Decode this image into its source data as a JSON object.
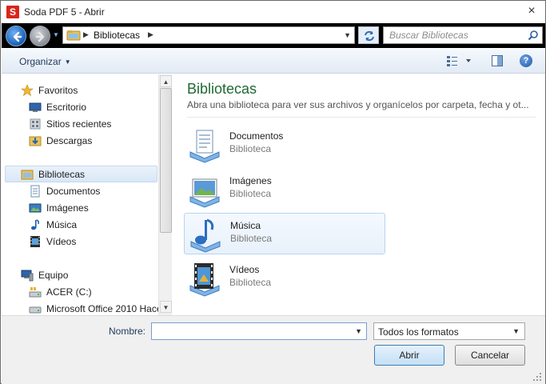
{
  "window": {
    "title": "Soda PDF 5 - Abrir",
    "app_icon_letter": "S",
    "close_glyph": "×"
  },
  "navbar": {
    "breadcrumb": "Bibliotecas",
    "search_placeholder": "Buscar Bibliotecas"
  },
  "commandbar": {
    "organize_label": "Organizar",
    "help_glyph": "?"
  },
  "navpane": {
    "items": [
      {
        "label": "Favoritos",
        "icon": "star-icon"
      },
      {
        "label": "Escritorio",
        "icon": "desktop-icon"
      },
      {
        "label": "Sitios recientes",
        "icon": "recent-places-icon"
      },
      {
        "label": "Descargas",
        "icon": "downloads-icon"
      },
      {
        "label": "Bibliotecas",
        "icon": "libraries-icon",
        "selected": true
      },
      {
        "label": "Documentos",
        "icon": "documents-icon"
      },
      {
        "label": "Imágenes",
        "icon": "pictures-icon"
      },
      {
        "label": "Música",
        "icon": "music-icon"
      },
      {
        "label": "Vídeos",
        "icon": "videos-icon"
      },
      {
        "label": "Equipo",
        "icon": "computer-icon"
      },
      {
        "label": "ACER (C:)",
        "icon": "drive-icon"
      },
      {
        "label": "Microsoft Office 2010 Hace",
        "icon": "drive-icon"
      }
    ]
  },
  "content": {
    "title": "Bibliotecas",
    "subtitle": "Abra una biblioteca para ver sus archivos y organícelos por carpeta, fecha y ot...",
    "libraries": [
      {
        "name": "Documentos",
        "type": "Biblioteca",
        "icon": "documents-library-icon"
      },
      {
        "name": "Imágenes",
        "type": "Biblioteca",
        "icon": "pictures-library-icon"
      },
      {
        "name": "Música",
        "type": "Biblioteca",
        "icon": "music-library-icon",
        "highlighted": true
      },
      {
        "name": "Vídeos",
        "type": "Biblioteca",
        "icon": "videos-library-icon"
      }
    ]
  },
  "bottom": {
    "name_label": "Nombre:",
    "name_value": "",
    "filter_value": "Todos los formatos",
    "open_label": "Abrir",
    "cancel_label": "Cancelar"
  },
  "colors": {
    "title_green": "#1e6a32",
    "accent_blue": "#1e395b"
  }
}
